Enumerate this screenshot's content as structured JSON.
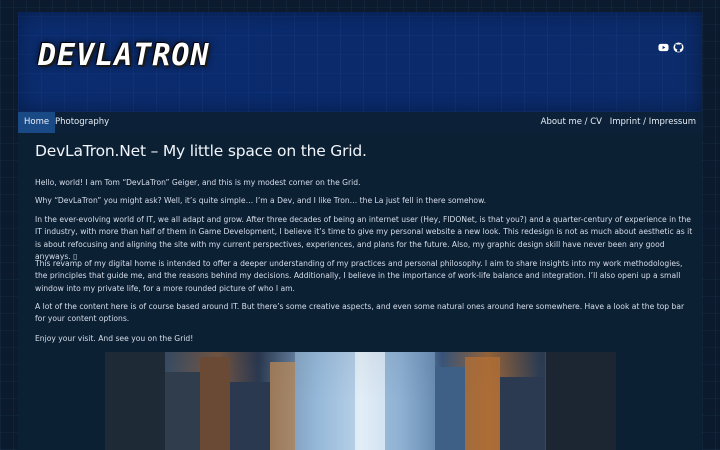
{
  "header": {
    "logo_text": "DEVLATRON",
    "social_icons": [
      "youtube-icon",
      "github-icon"
    ]
  },
  "nav": {
    "left": [
      "Home",
      "Photography"
    ],
    "right": [
      "About me / CV",
      "Imprint / Impressum"
    ],
    "active": "Home",
    "active_color": "#1a4a86"
  },
  "main": {
    "title": "DevLaTron.Net – My little space on the Grid.",
    "paragraphs": [
      "Hello, world! I am Tom “DevLaTron” Geiger, and this is my modest corner on the Grid.",
      "Why “DevLaTron” you might ask? Well, it’s quite simple… I’m a Dev, and I like Tron… the La just fell in there somehow.",
      "In the ever-evolving world of IT, we all adapt and grow. After three decades of being an internet user (Hey, FIDONet, is that you?) and a quarter-century of experience in the IT industry, with more than half of them in Game Development, I believe it’s time to give my personal website a new look. This redesign is not as much about aesthetic as it is about refocusing and aligning the site with my current perspectives, experiences, and plans for the future. Also, my graphic design skill have never been any good anyways. ▯",
      "This revamp of my digital home is intended to offer a deeper understanding of my practices and personal philosophy. I aim to share insights into my work methodologies, the principles that guide me, and the reasons behind my decisions. Additionally, I believe in the importance of work-life balance and integration. I’ll also openi up a small window into my private life, for a more rounded picture of who I am.",
      "A lot of the content here is of course based around IT. But there’s some creative aspects, and even some natural ones around here somewhere. Have a look at the top bar for your content options.",
      "Enjoy your visit. And see you on the Grid!"
    ]
  },
  "colors": {
    "banner": "#0b2c6e",
    "background": "#0b1a2c",
    "panel": "#0c2034"
  }
}
